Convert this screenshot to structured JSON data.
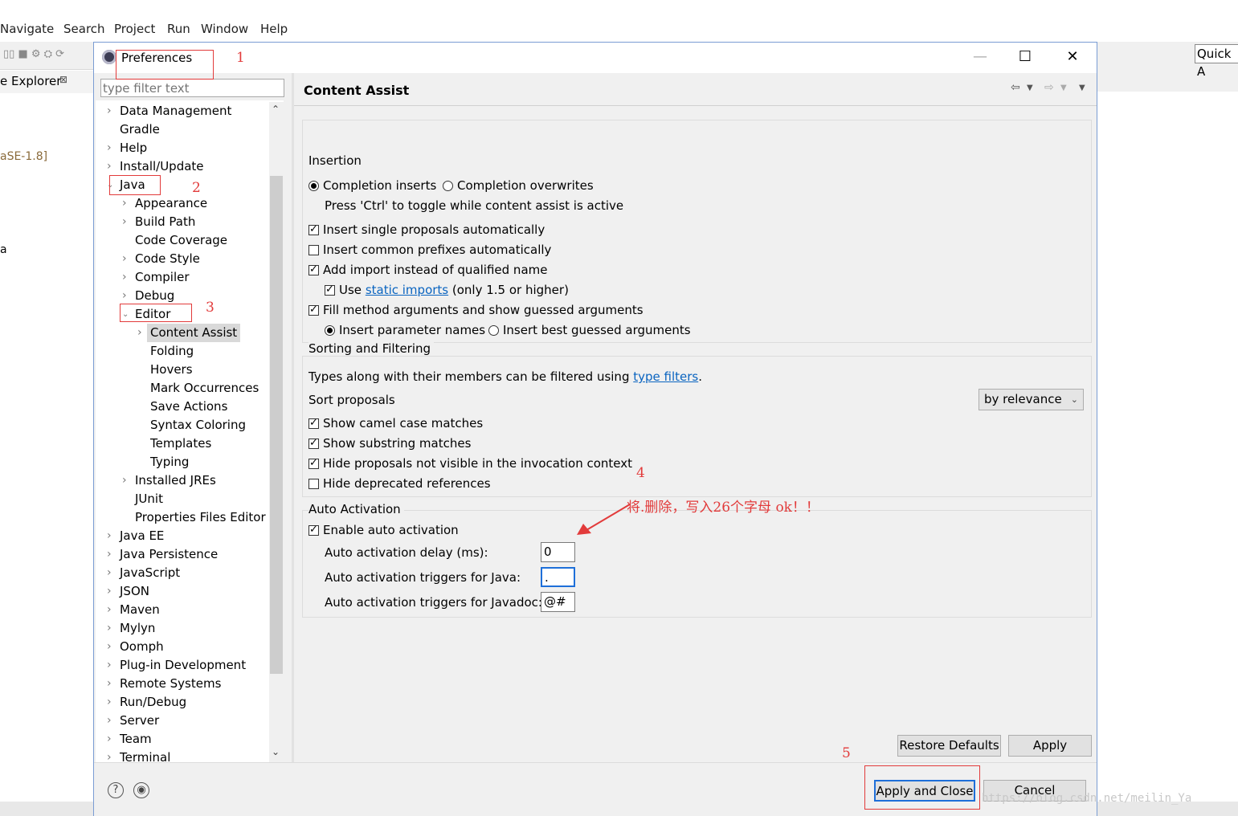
{
  "ide": {
    "menu": [
      "Navigate",
      "Search",
      "Project",
      "Run",
      "Window",
      "Help"
    ],
    "explorer_tab": "e Explorer",
    "side_texts": [
      "aSE-1.8]",
      "a"
    ],
    "quick_access": "Quick A"
  },
  "dialog": {
    "title": "Preferences",
    "filter_placeholder": "type filter text",
    "tree": [
      {
        "label": "Data Management",
        "level": 0,
        "expander": "collapsed"
      },
      {
        "label": "Gradle",
        "level": 0,
        "expander": "none"
      },
      {
        "label": "Help",
        "level": 0,
        "expander": "collapsed"
      },
      {
        "label": "Install/Update",
        "level": 0,
        "expander": "collapsed"
      },
      {
        "label": "Java",
        "level": 0,
        "expander": "expanded"
      },
      {
        "label": "Appearance",
        "level": 1,
        "expander": "collapsed"
      },
      {
        "label": "Build Path",
        "level": 1,
        "expander": "collapsed"
      },
      {
        "label": "Code Coverage",
        "level": 1,
        "expander": "none"
      },
      {
        "label": "Code Style",
        "level": 1,
        "expander": "collapsed"
      },
      {
        "label": "Compiler",
        "level": 1,
        "expander": "collapsed"
      },
      {
        "label": "Debug",
        "level": 1,
        "expander": "collapsed"
      },
      {
        "label": "Editor",
        "level": 1,
        "expander": "expanded"
      },
      {
        "label": "Content Assist",
        "level": 2,
        "expander": "collapsed",
        "selected": true
      },
      {
        "label": "Folding",
        "level": 2,
        "expander": "none"
      },
      {
        "label": "Hovers",
        "level": 2,
        "expander": "none"
      },
      {
        "label": "Mark Occurrences",
        "level": 2,
        "expander": "none"
      },
      {
        "label": "Save Actions",
        "level": 2,
        "expander": "none"
      },
      {
        "label": "Syntax Coloring",
        "level": 2,
        "expander": "none"
      },
      {
        "label": "Templates",
        "level": 2,
        "expander": "none"
      },
      {
        "label": "Typing",
        "level": 2,
        "expander": "none"
      },
      {
        "label": "Installed JREs",
        "level": 1,
        "expander": "collapsed"
      },
      {
        "label": "JUnit",
        "level": 1,
        "expander": "none"
      },
      {
        "label": "Properties Files Editor",
        "level": 1,
        "expander": "none"
      },
      {
        "label": "Java EE",
        "level": 0,
        "expander": "collapsed"
      },
      {
        "label": "Java Persistence",
        "level": 0,
        "expander": "collapsed"
      },
      {
        "label": "JavaScript",
        "level": 0,
        "expander": "collapsed"
      },
      {
        "label": "JSON",
        "level": 0,
        "expander": "collapsed"
      },
      {
        "label": "Maven",
        "level": 0,
        "expander": "collapsed"
      },
      {
        "label": "Mylyn",
        "level": 0,
        "expander": "collapsed"
      },
      {
        "label": "Oomph",
        "level": 0,
        "expander": "collapsed"
      },
      {
        "label": "Plug-in Development",
        "level": 0,
        "expander": "collapsed"
      },
      {
        "label": "Remote Systems",
        "level": 0,
        "expander": "collapsed"
      },
      {
        "label": "Run/Debug",
        "level": 0,
        "expander": "collapsed"
      },
      {
        "label": "Server",
        "level": 0,
        "expander": "collapsed"
      },
      {
        "label": "Team",
        "level": 0,
        "expander": "collapsed"
      },
      {
        "label": "Terminal",
        "level": 0,
        "expander": "collapsed"
      }
    ],
    "page_title": "Content Assist",
    "insertion": {
      "label": "Insertion",
      "completion_inserts": "Completion inserts",
      "completion_overwrites": "Completion overwrites",
      "toggle_hint": "Press 'Ctrl' to toggle while content assist is active",
      "insert_single": "Insert single proposals automatically",
      "insert_common": "Insert common prefixes automatically",
      "add_import": "Add import instead of qualified name",
      "use_label": "Use",
      "static_imports": "static imports",
      "use_suffix": "(only 1.5 or higher)",
      "fill_args": "Fill method arguments and show guessed arguments",
      "insert_param_names": "Insert parameter names",
      "insert_best_guessed": "Insert best guessed arguments"
    },
    "sorting": {
      "label": "Sorting and Filtering",
      "desc_prefix": "Types along with their members can be filtered using",
      "type_filters": "type filters",
      "desc_suffix": ".",
      "sort_proposals": "Sort proposals",
      "sort_value": "by relevance",
      "camel": "Show camel case matches",
      "substring": "Show substring matches",
      "hide_not_visible": "Hide proposals not visible in the invocation context",
      "hide_deprecated": "Hide deprecated references"
    },
    "auto": {
      "label": "Auto Activation",
      "enable": "Enable auto activation",
      "delay_label": "Auto activation delay (ms):",
      "delay_value": "0",
      "java_label": "Auto activation triggers for Java:",
      "java_value": ".",
      "javadoc_label": "Auto activation triggers for Javadoc:",
      "javadoc_value": "@#"
    },
    "buttons": {
      "restore": "Restore Defaults",
      "apply": "Apply",
      "apply_close": "Apply and Close",
      "cancel": "Cancel"
    }
  },
  "annotations": {
    "numbers": [
      "1",
      "2",
      "3",
      "4",
      "5"
    ],
    "note": "将.删除，写入26个字母 ok！！",
    "color": "#e23b3b"
  },
  "watermark": "https://blog.csdn.net/meilin_Ya"
}
